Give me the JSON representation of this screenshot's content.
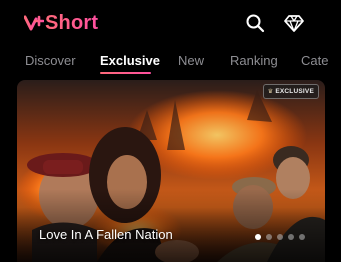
{
  "header": {
    "logo_text": "Short",
    "logo_mark_icon": "v-plus-logo-icon",
    "search_icon": "search-icon",
    "vip_icon": "diamond-icon"
  },
  "tabs": [
    {
      "label": "Discover",
      "active": false
    },
    {
      "label": "Exclusive",
      "active": true
    },
    {
      "label": "New",
      "active": false
    },
    {
      "label": "Ranking",
      "active": false
    },
    {
      "label": "Cate",
      "active": false
    }
  ],
  "banner": {
    "badge": "EXCLUSIVE",
    "title": "Love In A Fallen Nation",
    "slide_count": 5,
    "active_slide": 1
  },
  "colors": {
    "accent_start": "#ff6a7a",
    "accent_end": "#ff4fa0",
    "tab_inactive": "#8e8e93",
    "background": "#000000"
  }
}
